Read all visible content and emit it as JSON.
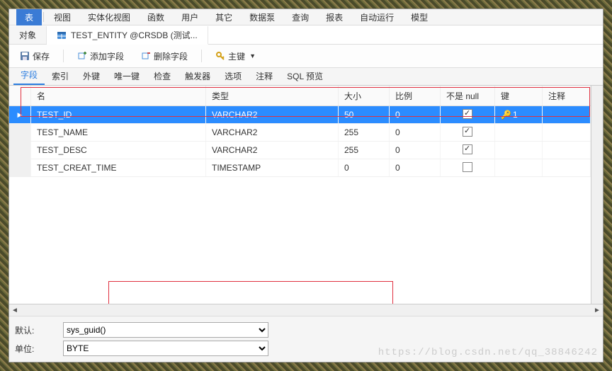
{
  "menu": {
    "items": [
      "表",
      "视图",
      "实体化视图",
      "函数",
      "用户",
      "其它",
      "数据泵",
      "查询",
      "报表",
      "自动运行",
      "模型"
    ],
    "activeIndex": 0
  },
  "tabs": {
    "objectTab": "对象",
    "activeTab": "TEST_ENTITY @CRSDB (测试..."
  },
  "toolbar": {
    "save": "保存",
    "addField": "添加字段",
    "delField": "删除字段",
    "primaryKey": "主键"
  },
  "subtabs": {
    "items": [
      "字段",
      "索引",
      "外键",
      "唯一键",
      "检查",
      "触发器",
      "选项",
      "注释",
      "SQL 预览"
    ],
    "activeIndex": 0
  },
  "columnsHeader": {
    "name": "名",
    "type": "类型",
    "size": "大小",
    "scale": "比例",
    "notNull": "不是 null",
    "key": "键",
    "comment": "注释"
  },
  "rows": [
    {
      "name": "TEST_ID",
      "type": "VARCHAR2",
      "size": "50",
      "scale": "0",
      "notNull": true,
      "key": "1",
      "selected": true
    },
    {
      "name": "TEST_NAME",
      "type": "VARCHAR2",
      "size": "255",
      "scale": "0",
      "notNull": true,
      "key": ""
    },
    {
      "name": "TEST_DESC",
      "type": "VARCHAR2",
      "size": "255",
      "scale": "0",
      "notNull": true,
      "key": ""
    },
    {
      "name": "TEST_CREAT_TIME",
      "type": "TIMESTAMP",
      "size": "0",
      "scale": "0",
      "notNull": false,
      "key": ""
    }
  ],
  "form": {
    "defaultLabel": "默认:",
    "defaultValue": "sys_guid()",
    "unitLabel": "单位:",
    "unitValue": "BYTE"
  },
  "watermark": "https://blog.csdn.net/qq_38846242"
}
